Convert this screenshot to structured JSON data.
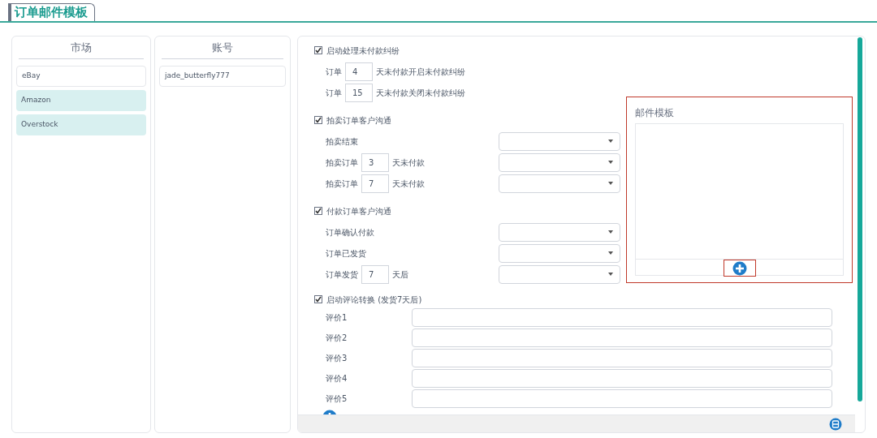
{
  "title": "订单邮件模板",
  "markets": {
    "header": "市场",
    "items": [
      {
        "label": "eBay",
        "selected": false
      },
      {
        "label": "Amazon",
        "selected": true
      },
      {
        "label": "Overstock",
        "selected": true
      }
    ]
  },
  "accounts": {
    "header": "账号",
    "items": [
      {
        "label": "jade_butterfly777",
        "selected": false
      }
    ]
  },
  "sections": [
    {
      "label": "启动处理未付款纠纷",
      "checked": true,
      "rows": [
        {
          "kind": "days",
          "prefix": "订单",
          "value": "4",
          "suffix": "天未付款开启未付款纠纷"
        },
        {
          "kind": "days",
          "prefix": "订单",
          "value": "15",
          "suffix": "天未付款关闭未付款纠纷"
        }
      ]
    },
    {
      "label": "拍卖订单客户沟通",
      "checked": true,
      "rows": [
        {
          "kind": "label_select",
          "prefix": "拍卖结束"
        },
        {
          "kind": "days_select",
          "prefix": "拍卖订单",
          "value": "3",
          "suffix": "天未付款"
        },
        {
          "kind": "days_select",
          "prefix": "拍卖订单",
          "value": "7",
          "suffix": "天未付款"
        }
      ]
    },
    {
      "label": "付款订单客户沟通",
      "checked": true,
      "rows": [
        {
          "kind": "label_select",
          "prefix": "订单确认付款"
        },
        {
          "kind": "label_select",
          "prefix": "订单已发货"
        },
        {
          "kind": "days_select",
          "prefix": "订单发货",
          "value": "7",
          "suffix": "天后"
        }
      ]
    }
  ],
  "reviews": {
    "label": "启动评论转换 (发货7天后)",
    "checked": true,
    "fields": [
      {
        "label": "评价1"
      },
      {
        "label": "评价2"
      },
      {
        "label": "评价3"
      },
      {
        "label": "评价4"
      },
      {
        "label": "评价5"
      }
    ]
  },
  "template_panel": {
    "title": "邮件模板"
  }
}
